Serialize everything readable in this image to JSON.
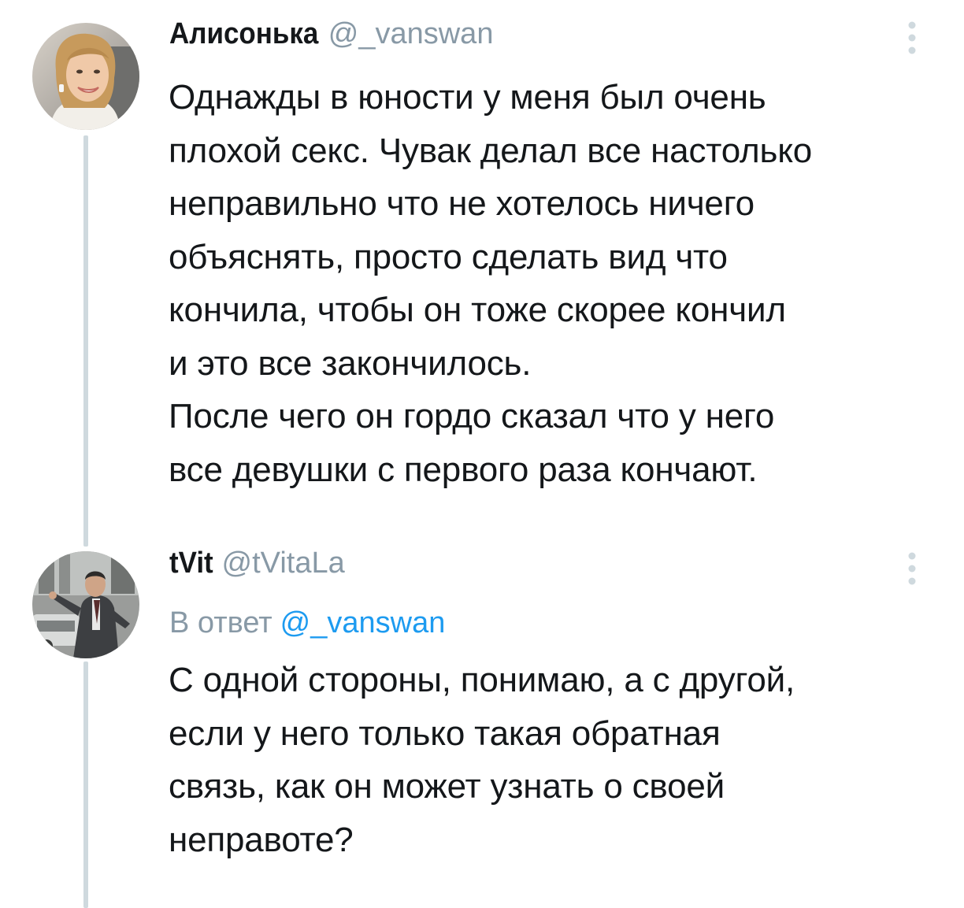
{
  "tweets": [
    {
      "display_name": "Алисонька",
      "handle": "@_vanswan",
      "avatar_icon": "user-avatar-photo-woman",
      "text": "Однажды в юности у меня был очень\nплохой секс. Чувак делал все настолько\nнеправильно что не хотелось ничего\nобъяснять, просто сделать вид что\nкончила, чтобы он тоже скорее кончил\nи это все закончилось.\nПосле чего он гордо сказал что у него\nвсе девушки с первого раза кончают."
    },
    {
      "display_name": "tVit",
      "handle": "@tVitaLa",
      "avatar_icon": "user-avatar-photo-man",
      "reply_prefix": "В ответ",
      "reply_handle": "@_vanswan",
      "text": "С одной стороны, понимаю, а с другой,\nесли у него только такая обратная\nсвязь, как он может узнать о своей\nнеправоте?"
    }
  ],
  "colors": {
    "text": "#14171a",
    "secondary": "#8899a6",
    "link": "#1d9bf0",
    "thread_line": "#cfd9de"
  },
  "icons": {
    "more": "more-vertical-icon"
  }
}
